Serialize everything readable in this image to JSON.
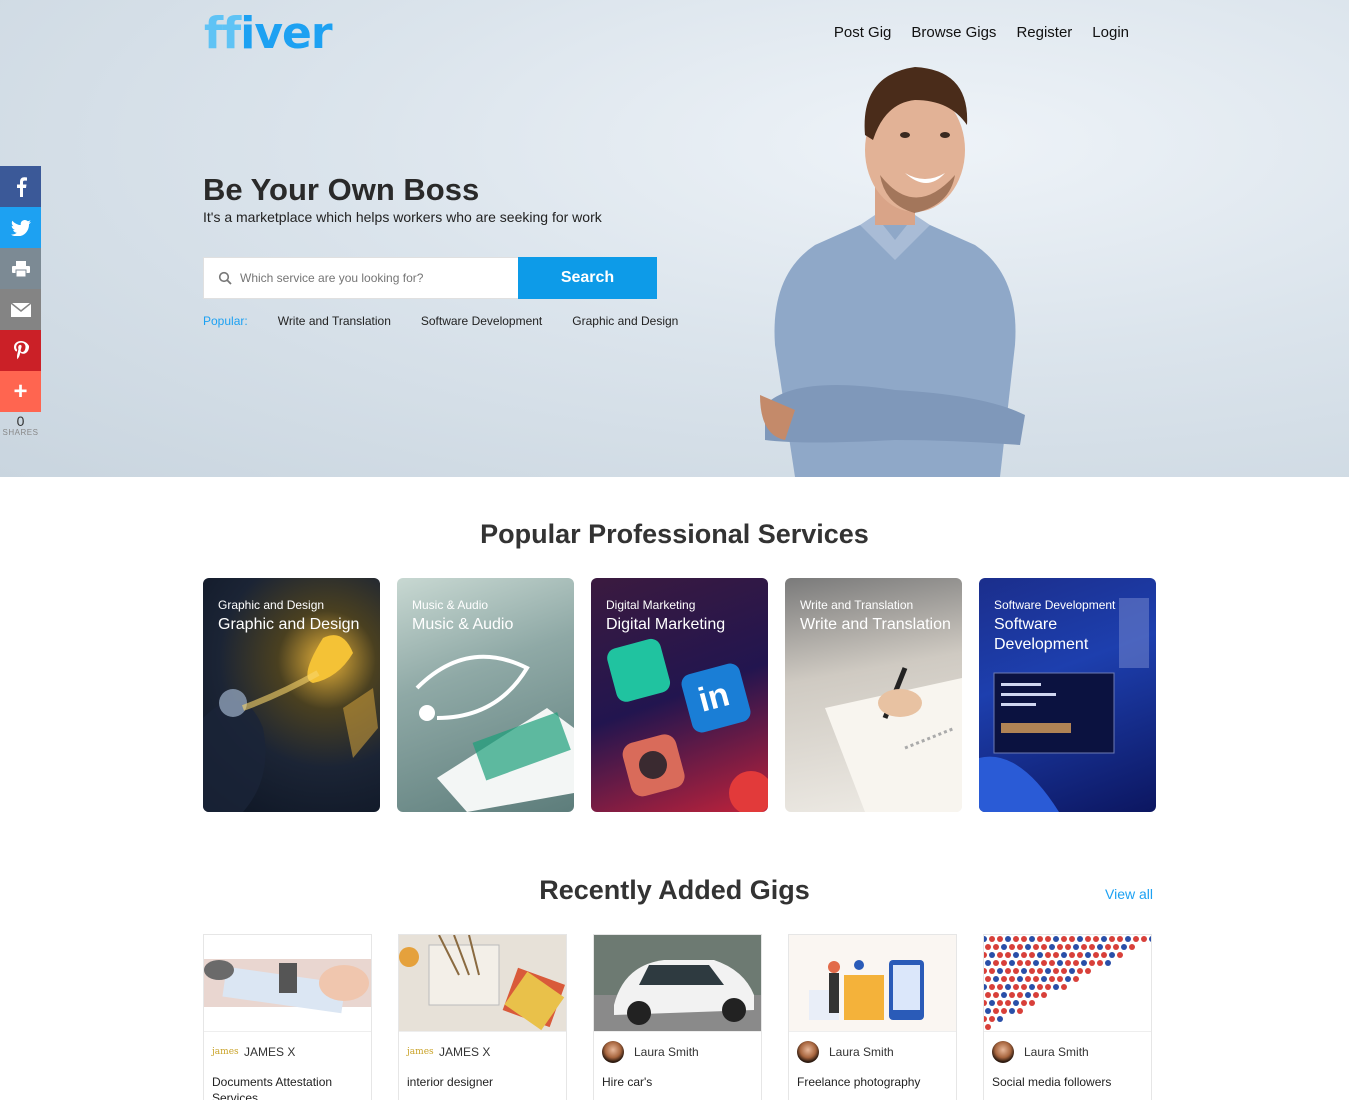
{
  "brand": {
    "logo_prefix": "ff",
    "logo_suffix": "iver"
  },
  "nav": [
    "Post Gig",
    "Browse Gigs",
    "Register",
    "Login"
  ],
  "hero": {
    "title": "Be Your Own Boss",
    "subtitle": "It's a marketplace which helps workers who are seeking for work",
    "search_placeholder": "Which service are you looking for?",
    "search_button": "Search",
    "popular_label": "Popular:",
    "popular_tags": [
      "Write and Translation",
      "Software Development",
      "Graphic and Design"
    ]
  },
  "social": {
    "buttons": [
      "facebook-icon",
      "twitter-icon",
      "print-icon",
      "email-icon",
      "pinterest-icon",
      "add-icon"
    ],
    "share_count": "0",
    "share_label": "SHARES"
  },
  "services": {
    "title": "Popular Professional Services",
    "cards": [
      {
        "small": "Graphic and Design",
        "big": "Graphic and Design"
      },
      {
        "small": "Music & Audio",
        "big": "Music & Audio"
      },
      {
        "small": "Digital Marketing",
        "big": "Digital Marketing"
      },
      {
        "small": "Write and Translation",
        "big": "Write and Translation"
      },
      {
        "small": "Software Development",
        "big": "Software Development"
      }
    ]
  },
  "gigs": {
    "title": "Recently Added Gigs",
    "view_all": "View all",
    "items": [
      {
        "author": "JAMES X",
        "avatar_text": "james",
        "title": "Documents Attestation Services"
      },
      {
        "author": "JAMES X",
        "avatar_text": "james",
        "title": "interior designer"
      },
      {
        "author": "Laura Smith",
        "avatar_text": "",
        "title": "Hire car's"
      },
      {
        "author": "Laura Smith",
        "avatar_text": "",
        "title": "Freelance photography"
      },
      {
        "author": "Laura Smith",
        "avatar_text": "",
        "title": "Social media followers"
      }
    ]
  },
  "colors": {
    "accent": "#1da1f2",
    "search_button": "#0d9be8"
  }
}
